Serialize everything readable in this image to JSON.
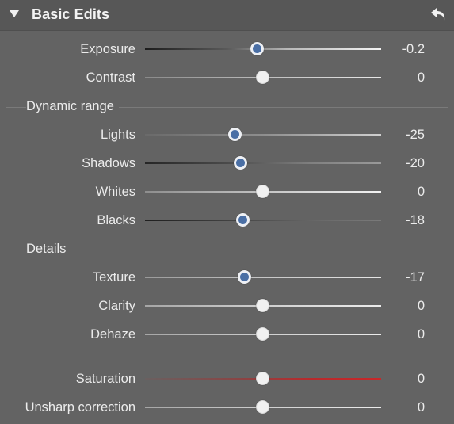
{
  "panel": {
    "title": "Basic Edits",
    "collapse_icon": "triangle-down-icon",
    "reset_icon": "undo-arrow-icon"
  },
  "sliders": {
    "exposure": {
      "label": "Exposure",
      "value": "-0.2"
    },
    "contrast": {
      "label": "Contrast",
      "value": "0"
    },
    "lights": {
      "label": "Lights",
      "value": "-25"
    },
    "shadows": {
      "label": "Shadows",
      "value": "-20"
    },
    "whites": {
      "label": "Whites",
      "value": "0"
    },
    "blacks": {
      "label": "Blacks",
      "value": "-18"
    },
    "texture": {
      "label": "Texture",
      "value": "-17"
    },
    "clarity": {
      "label": "Clarity",
      "value": "0"
    },
    "dehaze": {
      "label": "Dehaze",
      "value": "0"
    },
    "saturation": {
      "label": "Saturation",
      "value": "0"
    },
    "unsharp": {
      "label": "Unsharp correction",
      "value": "0"
    }
  },
  "sections": {
    "dynamic_range": "Dynamic range",
    "details": "Details"
  },
  "colors": {
    "background": "#636363",
    "header": "#575757",
    "knob_active": "#4a6fa5",
    "saturation_track": "#c0282a"
  }
}
